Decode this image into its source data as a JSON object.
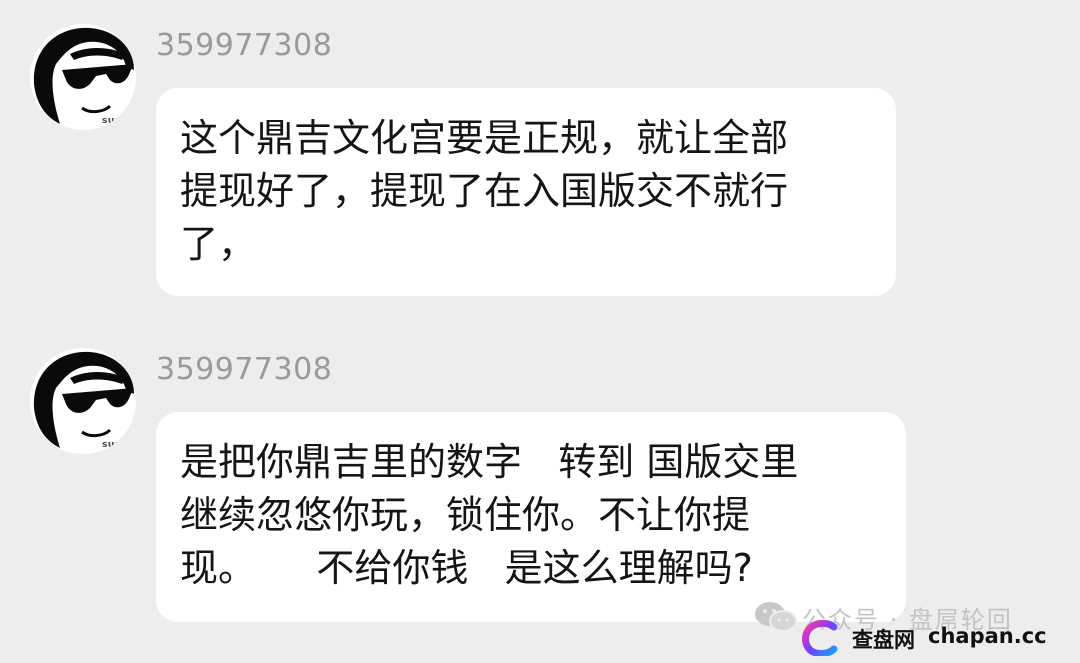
{
  "messages": [
    {
      "sender": "359977308",
      "avatar_caption": "summ",
      "text": "这个鼎吉文化宫要是正规，就让全部\n提现好了，提现了在入国版交不就行\n了，"
    },
    {
      "sender": "359977308",
      "avatar_caption": "summ",
      "text": "是把你鼎吉里的数字   转到 国版交里\n继续忽悠你玩，锁住你。不让你提\n现。     不给你钱   是这么理解吗?"
    }
  ],
  "watermark": {
    "account": "公众号 · 盘屌轮回",
    "brand": "查盘网",
    "domain": "chapan.cc",
    "icon_wechat": "wechat-icon",
    "icon_logo": "chapan-logo-icon"
  },
  "colors": {
    "background": "#ededed",
    "bubble": "#ffffff",
    "sender": "#9a9a9a",
    "text": "#151515",
    "logo_gradient": [
      "#ff3aa0",
      "#7a3cff",
      "#1aa0ff"
    ]
  }
}
